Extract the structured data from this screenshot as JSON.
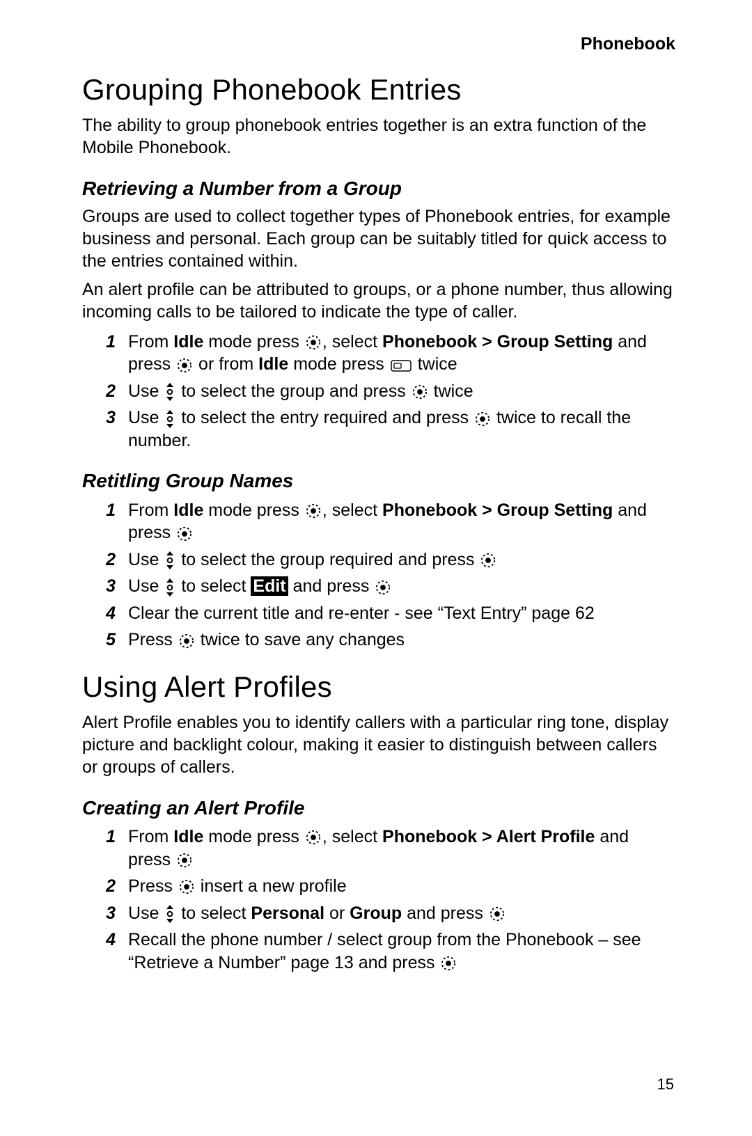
{
  "running_head": "Phonebook",
  "page_number": "15",
  "h1_grouping": "Grouping Phonebook Entries",
  "p_grouping_intro": "The ability to group phonebook entries together is an extra function of the Mobile Phonebook.",
  "h2_retrieving": "Retrieving a Number from a Group",
  "p_retrieving_1": "Groups are used to collect together types of Phonebook entries, for example business and personal. Each group can be suitably titled for quick access to the entries contained within.",
  "p_retrieving_2": "An alert profile can be attributed to groups, or a phone number, thus allowing incoming calls to be tailored to indicate the type of caller.",
  "retrieving_steps": {
    "s1": {
      "n": "1",
      "t_from": "From ",
      "t_idle": "Idle",
      "t_mode_press": " mode press ",
      "t_select": ", select ",
      "t_path": "Phonebook > Group Setting",
      "t_and_press": " and press ",
      "t_or_from": "  or from ",
      "t_idle2": "Idle",
      "t_mode_press2": " mode press ",
      "t_twice": "  twice"
    },
    "s2": {
      "n": "2",
      "t_use": "Use ",
      "t_to_select_group": " to select the group and press ",
      "t_twice": " twice"
    },
    "s3": {
      "n": "3",
      "t_use": "Use ",
      "t_to_select_entry": " to select the entry required and press ",
      "t_twice_recall": " twice to recall the number."
    }
  },
  "h2_retitling": "Retitling Group Names",
  "retitling_steps": {
    "s1": {
      "n": "1",
      "t_from": "From ",
      "t_idle": "Idle",
      "t_mode_press": " mode press ",
      "t_select": ", select ",
      "t_path": "Phonebook > Group Setting",
      "t_and_press": " and press "
    },
    "s2": {
      "n": "2",
      "t_use": "Use ",
      "t_to_select": " to select the group required and press "
    },
    "s3": {
      "n": "3",
      "t_use": "Use ",
      "t_to_select": " to select ",
      "t_edit": "Edit",
      "t_and_press": " and press "
    },
    "s4": {
      "n": "4",
      "t": "Clear the current title and re-enter - see “Text Entry” page 62"
    },
    "s5": {
      "n": "5",
      "t_press": "Press ",
      "t_twice_save": " twice to save any changes"
    }
  },
  "h1_alert": "Using Alert Profiles",
  "p_alert_intro": "Alert Profile enables you to identify callers with a particular ring tone, display picture and backlight colour, making it easier to distinguish between callers or groups of callers.",
  "h2_creating": "Creating an Alert Profile",
  "creating_steps": {
    "s1": {
      "n": "1",
      "t_from": "From ",
      "t_idle": "Idle",
      "t_mode_press": " mode press ",
      "t_select": ", select ",
      "t_path": "Phonebook > Alert Profile",
      "t_and_press": " and press "
    },
    "s2": {
      "n": "2",
      "t_press": "Press ",
      "t_insert": " insert a new profile"
    },
    "s3": {
      "n": "3",
      "t_use": "Use ",
      "t_to_select": " to select ",
      "t_personal": "Personal",
      "t_or": " or ",
      "t_group": "Group",
      "t_and_press": " and press "
    },
    "s4": {
      "n": "4",
      "t_recall": "Recall the phone number / select group from the Phonebook – see “Retrieve a Number” page 13 and press "
    }
  }
}
